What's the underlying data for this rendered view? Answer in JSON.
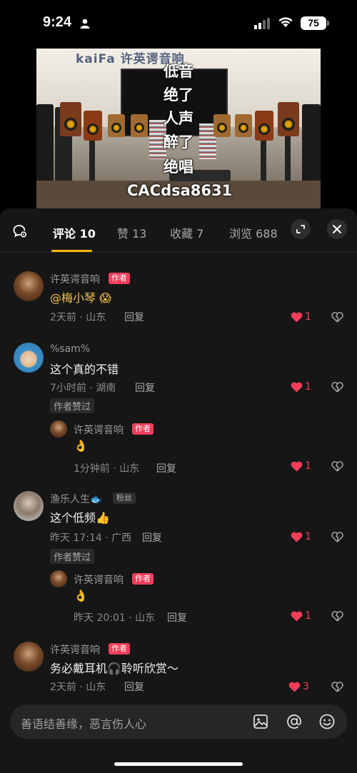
{
  "status_bar": {
    "time": "9:24",
    "battery": "75"
  },
  "video": {
    "brand": "kaiFa 许英谔音响",
    "overlay_lines": [
      "低音",
      "绝了",
      "人声",
      "醉了",
      "绝唱",
      "CACdsa8631"
    ]
  },
  "tabs": [
    {
      "label": "评论 10",
      "active": true
    },
    {
      "label": "赞 13"
    },
    {
      "label": "收藏 7"
    },
    {
      "label": "浏览 688"
    }
  ],
  "icons": {
    "comment_settings": "comment-settings-icon",
    "expand": "expand-icon",
    "close": "close-icon",
    "like": "heart-icon",
    "dislike": "broken-heart-icon",
    "image": "image-icon",
    "mention": "at-icon",
    "emoji": "emoji-icon"
  },
  "colors": {
    "accent": "#f5b800",
    "like": "#f23d5a",
    "sheet_bg": "#161616"
  },
  "comments": [
    {
      "user": "许英谔音响",
      "badge": "作者",
      "text": "@梅小琴 😱",
      "meta": "2天前 · 山东",
      "reply": "回复",
      "likes": "1"
    },
    {
      "user": "%sam%",
      "text": "这个真的不错",
      "meta": "7小时前 · 湖南",
      "reply": "回复",
      "likes": "1",
      "author_liked": "作者赞过",
      "sub": {
        "user": "许英谔音响",
        "badge": "作者",
        "text": "👌",
        "meta": "1分钟前 · 山东",
        "reply": "回复",
        "likes": "1"
      }
    },
    {
      "user": "渔乐人生🐟",
      "badge": "粉丝",
      "text": "这个低频👍",
      "meta": "昨天 17:14 · 广西",
      "reply": "回复",
      "likes": "1",
      "author_liked": "作者赞过",
      "sub": {
        "user": "许英谔音响",
        "badge": "作者",
        "text": "👌",
        "meta": "昨天 20:01 · 山东",
        "reply": "回复",
        "likes": "1"
      }
    },
    {
      "user": "许英谔音响",
      "badge": "作者",
      "text": "务必戴耳机🎧聆听欣赏～",
      "meta": "2天前 · 山东",
      "reply": "回复",
      "likes": "3"
    }
  ],
  "input": {
    "placeholder": "善语结善缘，恶言伤人心"
  }
}
